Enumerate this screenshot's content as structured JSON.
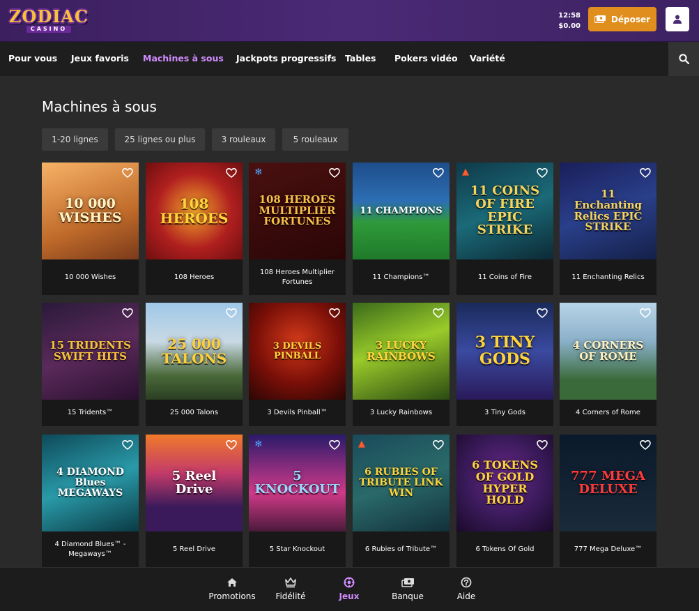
{
  "header": {
    "logo_main": "ZODIAC",
    "logo_sub": "CASINO",
    "time": "12:58",
    "balance": "$0.00",
    "deposit_label": "Déposer"
  },
  "nav": {
    "items": [
      "Pour vous",
      "Jeux favoris",
      "Machines à sous",
      "Jackpots progressifs",
      "Tables",
      "Pokers vidéo",
      "Variété"
    ],
    "active": "Machines à sous"
  },
  "page": {
    "title": "Machines à sous",
    "filters": [
      "1-20 lignes",
      "25 lignes ou plus",
      "3 rouleaux",
      "5 rouleaux"
    ]
  },
  "games": [
    {
      "name": "10 000 Wishes",
      "art": "10 000 WISHES",
      "badge": ""
    },
    {
      "name": "108 Heroes",
      "art": "108 HEROES",
      "badge": ""
    },
    {
      "name": "108 Heroes Multiplier Fortunes",
      "art": "108 HEROES MULTIPLIER FORTUNES",
      "badge": "snow"
    },
    {
      "name": "11 Champions™",
      "art": "11 CHAMPIONS",
      "badge": ""
    },
    {
      "name": "11 Coins of Fire",
      "art": "11 COINS OF FIRE EPIC STRIKE",
      "badge": "hot"
    },
    {
      "name": "11 Enchanting Relics",
      "art": "11 Enchanting Relics EPIC STRIKE",
      "badge": ""
    },
    {
      "name": "15 Tridents™",
      "art": "15 TRIDENTS SWIFT HITS",
      "badge": ""
    },
    {
      "name": "25 000 Talons",
      "art": "25 000 TALONS",
      "badge": ""
    },
    {
      "name": "3 Devils Pinball™",
      "art": "3 DEVILS PINBALL",
      "badge": ""
    },
    {
      "name": "3 Lucky Rainbows",
      "art": "3 LUCKY RAINBOWS",
      "badge": ""
    },
    {
      "name": "3 Tiny Gods",
      "art": "3 TINY GODS",
      "badge": ""
    },
    {
      "name": "4 Corners of Rome",
      "art": "4 CORNERS OF ROME",
      "badge": ""
    },
    {
      "name": "4 Diamond Blues™ - Megaways™",
      "art": "4 DIAMOND Blues MEGAWAYS",
      "badge": ""
    },
    {
      "name": "5 Reel Drive",
      "art": "5 Reel Drive",
      "badge": ""
    },
    {
      "name": "5 Star Knockout",
      "art": "5 KNOCKOUT",
      "badge": "snow"
    },
    {
      "name": "6 Rubies of Tribute™",
      "art": "6 RUBIES OF TRIBUTE LINK WIN",
      "badge": "hot"
    },
    {
      "name": "6 Tokens Of Gold",
      "art": "6 TOKENS OF GOLD HYPER HOLD",
      "badge": ""
    },
    {
      "name": "777 Mega Deluxe™",
      "art": "777 MEGA DELUXE",
      "badge": ""
    }
  ],
  "bottom_nav": {
    "items": [
      "Promotions",
      "Fidélité",
      "Jeux",
      "Banque",
      "Aide"
    ],
    "active": "Jeux"
  },
  "colors": {
    "header_bg": "#4a2a75",
    "accent": "#d18cff",
    "deposit": "#e08e1d",
    "page_bg": "#2a2a2a"
  }
}
